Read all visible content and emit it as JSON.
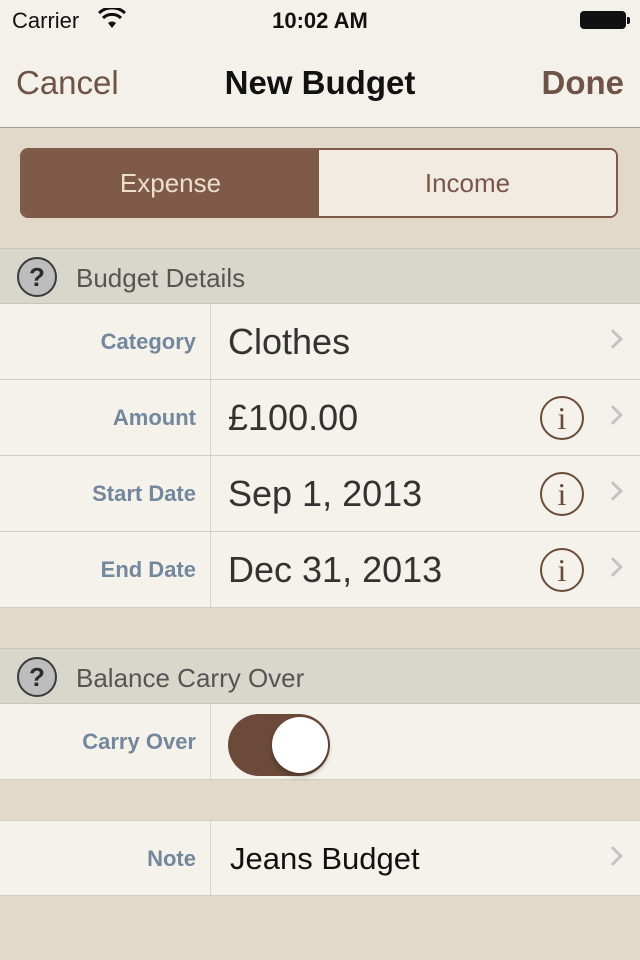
{
  "status_bar": {
    "carrier": "Carrier",
    "time": "10:02 AM"
  },
  "nav": {
    "cancel": "Cancel",
    "title": "New Budget",
    "done": "Done"
  },
  "type_selector": {
    "options": [
      "Expense",
      "Income"
    ],
    "selected": "Expense"
  },
  "sections": {
    "details": {
      "title": "Budget Details",
      "rows": [
        {
          "label": "Category",
          "value": "Clothes"
        },
        {
          "label": "Amount",
          "value": "£100.00"
        },
        {
          "label": "Start Date",
          "value": "Sep 1, 2013"
        },
        {
          "label": "End Date",
          "value": "Dec 31, 2013"
        }
      ]
    },
    "carry": {
      "title": "Balance Carry Over",
      "label": "Carry Over",
      "enabled": true
    },
    "note": {
      "label": "Note",
      "value": "Jeans Budget"
    }
  },
  "icons": {
    "help": "?",
    "info": "i"
  }
}
